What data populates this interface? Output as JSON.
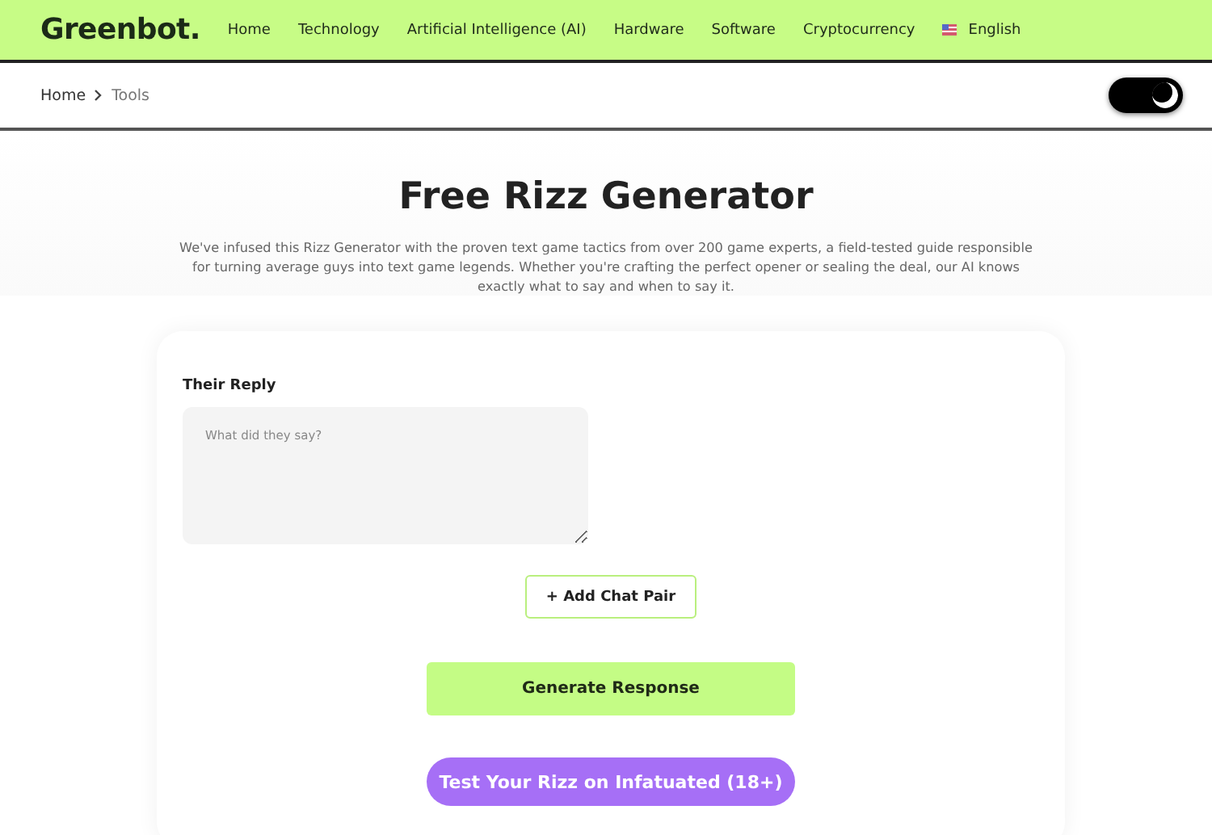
{
  "header": {
    "logo": "Greenbot.",
    "nav": [
      "Home",
      "Technology",
      "Artificial Intelligence (AI)",
      "Hardware",
      "Software",
      "Cryptocurrency"
    ],
    "language": "English"
  },
  "breadcrumb": {
    "items": [
      "Home",
      "Tools"
    ],
    "theme_toggle": {
      "on": true
    }
  },
  "hero": {
    "title": "Free Rizz Generator",
    "description": "We've infused this Rizz Generator with the proven text game tactics from over 200 game experts, a field-tested guide responsible for turning average guys into text game legends. Whether you're crafting the perfect opener or sealing the deal, our AI knows exactly what to say and when to say it."
  },
  "form": {
    "label": "Their Reply",
    "placeholder": "What did they say?",
    "add_button": "+ Add Chat Pair",
    "generate_button": "Generate Response",
    "test_button": "Test Your Rizz on Infatuated (18+)"
  }
}
